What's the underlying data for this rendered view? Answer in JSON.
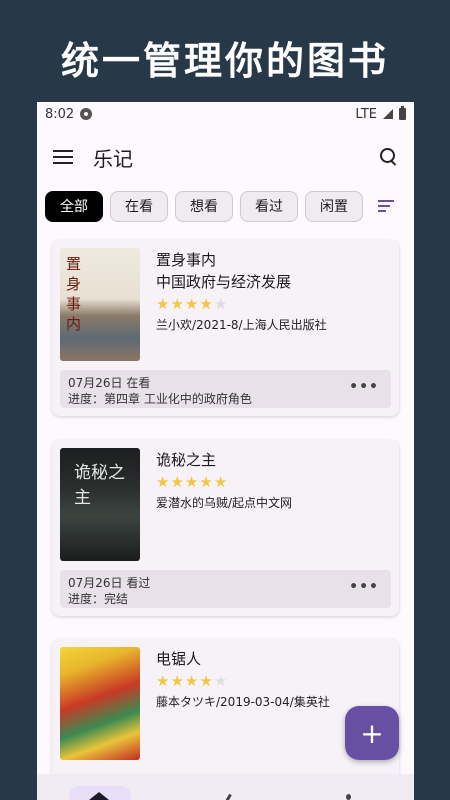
{
  "promo": {
    "title": "统一管理你的图书"
  },
  "status": {
    "time": "8:02",
    "network": "LTE",
    "settings_icon": "gear-icon"
  },
  "appbar": {
    "title": "乐记",
    "menu_icon": "menu-icon",
    "search_icon": "search-icon"
  },
  "filters": {
    "chips": [
      "全部",
      "在看",
      "想看",
      "看过",
      "闲置"
    ],
    "selected": "全部",
    "sort_icon": "sort-icon"
  },
  "books": [
    {
      "title": "置身事内",
      "subtitle": "中国政府与经济发展",
      "rating": 4,
      "meta": "兰小欢/2021-8/上海人民出版社",
      "note_line1": "07月26日 在看",
      "note_line2": "进度：第四章 工业化中的政府角色",
      "cover_text": "置身事内"
    },
    {
      "title": "诡秘之主",
      "subtitle": "",
      "rating": 5,
      "meta": "爱潜水的乌贼/起点中文网",
      "note_line1": "07月26日 看过",
      "note_line2": "进度：完结",
      "cover_text": "诡秘之主"
    },
    {
      "title": "电锯人",
      "subtitle": "",
      "rating": 4,
      "meta": "藤本タツキ/2019-03-04/集英社",
      "note_line1": "",
      "note_line2": "",
      "cover_text": ""
    }
  ],
  "fab": {
    "label": "+"
  },
  "colors": {
    "background": "#273849",
    "accent": "#6750a4",
    "star": "#f2c744"
  }
}
